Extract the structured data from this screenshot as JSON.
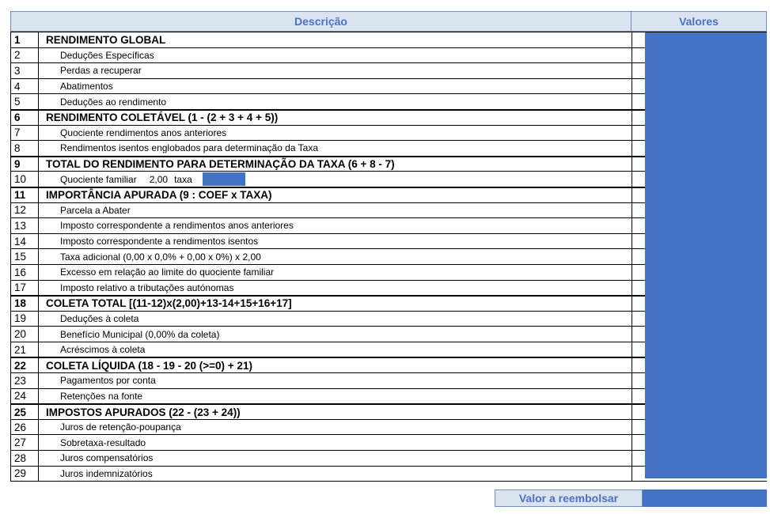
{
  "header": {
    "description_label": "Descrição",
    "values_label": "Valores"
  },
  "rows": [
    {
      "n": "1",
      "label": "RENDIMENTO GLOBAL",
      "bold": true
    },
    {
      "n": "2",
      "label": "Deduções Específicas"
    },
    {
      "n": "3",
      "label": "Perdas a recuperar"
    },
    {
      "n": "4",
      "label": "Abatimentos"
    },
    {
      "n": "5",
      "label": "Deduções ao rendimento"
    },
    {
      "n": "6",
      "label": "RENDIMENTO COLETÁVEL (1 - (2 + 3 + 4 + 5))",
      "bold": true
    },
    {
      "n": "7",
      "label": "Quociente rendimentos anos anteriores"
    },
    {
      "n": "8",
      "label": "Rendimentos isentos englobados para determinação da Taxa"
    },
    {
      "n": "9",
      "label": "TOTAL DO RENDIMENTO PARA DETERMINAÇÃO DA TAXA (6 + 8 - 7)",
      "bold": true
    },
    {
      "n": "10",
      "label": "Quociente familiar",
      "qf_value": "2,00",
      "qf_taxa": "taxa"
    },
    {
      "n": "11",
      "label": "IMPORTÂNCIA APURADA (9 : COEF x TAXA)",
      "bold": true
    },
    {
      "n": "12",
      "label": "Parcela a Abater"
    },
    {
      "n": "13",
      "label": "Imposto correspondente a rendimentos anos anteriores"
    },
    {
      "n": "14",
      "label": "Imposto correspondente a rendimentos isentos"
    },
    {
      "n": "15",
      "label": "Taxa adicional (0,00 x 0,0% + 0,00 x 0%) x 2,00"
    },
    {
      "n": "16",
      "label": "Excesso em relação ao limite do quociente familiar"
    },
    {
      "n": "17",
      "label": "Imposto relativo a tributações autónomas"
    },
    {
      "n": "18",
      "label": "COLETA TOTAL   [(11-12)x(2,00)+13-14+15+16+17]",
      "bold": true
    },
    {
      "n": "19",
      "label": "Deduções à coleta"
    },
    {
      "n": "20",
      "label": "Benefício Municipal  (0,00% da coleta)"
    },
    {
      "n": "21",
      "label": "Acréscimos à coleta"
    },
    {
      "n": "22",
      "label": "COLETA LÍQUIDA (18 - 19 - 20 (>=0) + 21)",
      "bold": true
    },
    {
      "n": "23",
      "label": "Pagamentos por conta"
    },
    {
      "n": "24",
      "label": "Retenções na fonte"
    },
    {
      "n": "25",
      "label": "IMPOSTOS APURADOS (22 - (23 + 24))",
      "bold": true
    },
    {
      "n": "26",
      "label": "Juros de retenção-poupança"
    },
    {
      "n": "27",
      "label": "Sobretaxa-resultado"
    },
    {
      "n": "28",
      "label": "Juros compensatórios"
    },
    {
      "n": "29",
      "label": "Juros indemnizatórios"
    }
  ],
  "footer": {
    "label": "Valor a reembolsar"
  },
  "colors": {
    "value_fill": "#4472c4",
    "header_fill": "#dbe3f1",
    "header_text": "#4a72c4"
  }
}
